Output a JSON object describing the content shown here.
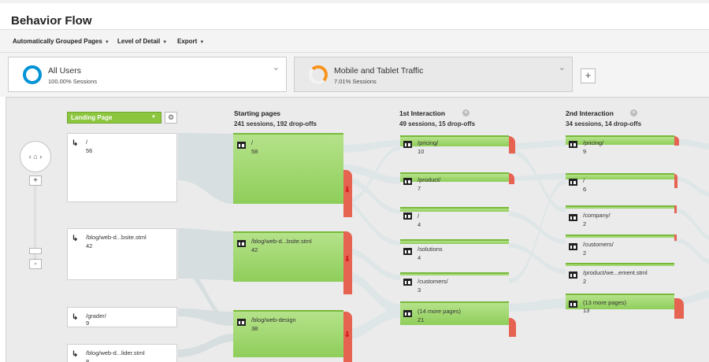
{
  "title": "Behavior Flow",
  "toolbar": {
    "grouped": "Automatically Grouped Pages",
    "detail": "Level of Detail",
    "export": "Export"
  },
  "segments": [
    {
      "name": "All Users",
      "sub": "100.00% Sessions"
    },
    {
      "name": "Mobile and Tablet Traffic",
      "sub": "7.01% Sessions"
    }
  ],
  "dimension": "Landing Page",
  "columns": [
    {
      "title": "Starting pages",
      "sub": "241 sessions, 192 drop-offs"
    },
    {
      "title": "1st Interaction",
      "sub": "49 sessions, 15 drop-offs"
    },
    {
      "title": "2nd Interaction",
      "sub": "34 sessions, 14 drop-offs"
    }
  ],
  "landing": [
    {
      "label": "/",
      "count": "56"
    },
    {
      "label": "/blog/web-d...bsite.stml",
      "count": "42"
    },
    {
      "label": "/grader/",
      "count": "9"
    },
    {
      "label": "/blog/web-d...lider.stml",
      "count": "8"
    }
  ],
  "starting": [
    {
      "label": "/",
      "count": "58"
    },
    {
      "label": "/blog/web-d...bsite.stml",
      "count": "42"
    },
    {
      "label": "/blog/web-design",
      "count": "38"
    }
  ],
  "first": [
    {
      "label": "/pricing/",
      "count": "10"
    },
    {
      "label": "/product/",
      "count": "7"
    },
    {
      "label": "/",
      "count": "4"
    },
    {
      "label": "/solutions",
      "count": "4"
    },
    {
      "label": "/customers/",
      "count": "3"
    },
    {
      "label": "(14 more pages)",
      "count": "21"
    }
  ],
  "second": [
    {
      "label": "/pricing/",
      "count": "9"
    },
    {
      "label": "/",
      "count": "6"
    },
    {
      "label": "/company/",
      "count": "2"
    },
    {
      "label": "/customers/",
      "count": "2"
    },
    {
      "label": "/product/we...ement.stml",
      "count": "2"
    },
    {
      "label": "(13 more pages)",
      "count": "13"
    }
  ],
  "icons": {
    "home": "home-icon",
    "gear": "gear-icon",
    "page": "page-icon",
    "landing": "landing-arrow-icon",
    "dropoff": "dropoff-arrow-icon"
  },
  "colors": {
    "node_green": "#8fce5a",
    "dropoff": "#e66352",
    "dimension_select": "#8cc63f",
    "all_users_ring": "#0093d6",
    "mobile_ring": "#f7941d"
  }
}
